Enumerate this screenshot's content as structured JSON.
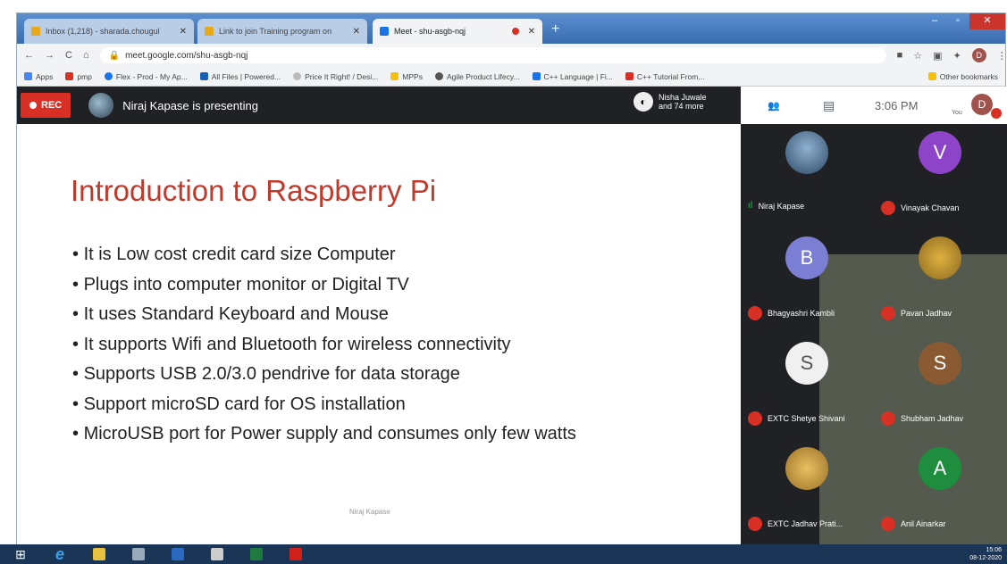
{
  "browser": {
    "tabs": [
      {
        "label": "Inbox (1,218) - sharada.chougul",
        "active": false
      },
      {
        "label": "Link to join Training program on",
        "active": false
      },
      {
        "label": "Meet - shu-asgb-nqj",
        "active": true
      }
    ],
    "url": "meet.google.com/shu-asgb-nqj",
    "profile_initial": "D",
    "bookmarks": [
      "Apps",
      "pmp",
      "Flex - Prod - My Ap...",
      "All Files | Powered...",
      "Price It Right! / Desi...",
      "MPPs",
      "Agile Product Lifecy...",
      "C++ Language | Fi...",
      "C++ Tutorial From...",
      "Other bookmarks"
    ]
  },
  "meet": {
    "rec_label": "REC",
    "presenter_text": "Niraj Kapase is presenting",
    "others_line1": "Nisha Juwale",
    "others_line2": "and 74 more",
    "time": "3:06 PM",
    "you_label": "You",
    "me_initial": "D"
  },
  "slide": {
    "title": "Introduction to Raspberry Pi",
    "bullets": [
      "It is Low cost credit card size Computer",
      "Plugs into computer monitor or Digital TV",
      "It uses Standard Keyboard and Mouse",
      "It supports Wifi and Bluetooth for wireless connectivity",
      "Supports USB 2.0/3.0 pendrive for data storage",
      "Support microSD card for OS installation",
      "MicroUSB port for Power supply and consumes only few watts"
    ],
    "footer": "Niraj Kapase"
  },
  "participants": [
    {
      "name": "Niraj Kapase",
      "initial": "",
      "color": "#4a6c8c",
      "muted": false
    },
    {
      "name": "Vinayak Chavan",
      "initial": "V",
      "color": "#8e44c9",
      "muted": true
    },
    {
      "name": "Bhagyashri Kambli",
      "initial": "B",
      "color": "#7b7fd4",
      "muted": true
    },
    {
      "name": "Pavan Jadhav",
      "initial": "",
      "color": "#c49030",
      "muted": true
    },
    {
      "name": "EXTC Shetye Shivani",
      "initial": "",
      "color": "#e8e8e8",
      "muted": true
    },
    {
      "name": "Shubham Jadhav",
      "initial": "S",
      "color": "#8a5a32",
      "muted": true
    },
    {
      "name": "EXTC Jadhav Prati...",
      "initial": "",
      "color": "#c9a040",
      "muted": true
    },
    {
      "name": "Anil Ainarkar",
      "initial": "A",
      "color": "#1e8e3e",
      "muted": true
    }
  ],
  "taskbar": {
    "tray_time": "15:06",
    "tray_date": "08-12-2020"
  }
}
